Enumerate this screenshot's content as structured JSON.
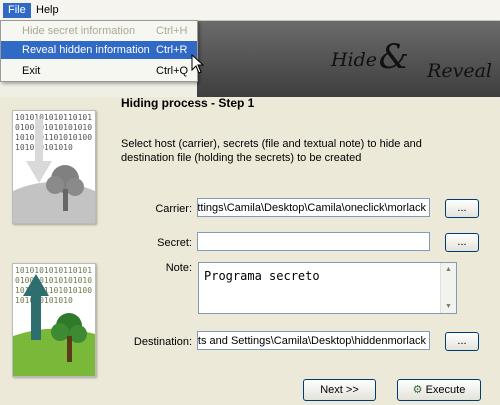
{
  "menubar": {
    "file": "File",
    "help": "Help"
  },
  "file_menu": [
    {
      "label": "Hide secret information",
      "shortcut": "Ctrl+H",
      "state": "disabled"
    },
    {
      "label": "Reveal hidden information",
      "shortcut": "Ctrl+R",
      "state": "highlighted"
    },
    {
      "label": "Exit",
      "shortcut": "Ctrl+Q",
      "state": "normal"
    }
  ],
  "banner": {
    "word1": "Hide",
    "amp": "&",
    "word2": "Reveal"
  },
  "binary_text": "101010101011010101001010101010101010101101010100101010101010",
  "step_title": "Hiding process - Step 1",
  "instructions": "Select host (carrier), secrets (file and textual note) to hide and destination file (holding the secrets) to be created",
  "fields": {
    "carrier_label": "Carrier:",
    "carrier_value": "ettings\\Camila\\Desktop\\Camila\\oneclick\\morlack",
    "secret_label": "Secret:",
    "secret_value": "",
    "note_label": "Note:",
    "note_value": "Programa secreto",
    "destination_label": "Destination:",
    "destination_value": "nts and Settings\\Camila\\Desktop\\hiddenmorlack",
    "browse": "..."
  },
  "buttons": {
    "next": "Next >>",
    "execute": "Execute"
  }
}
